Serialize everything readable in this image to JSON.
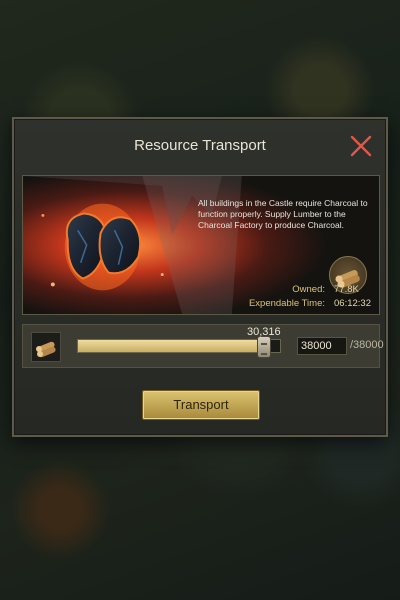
{
  "dialog": {
    "title": "Resource Transport",
    "description": "All buildings in the Castle require Charcoal to function properly. Supply Lumber to the Charcoal Factory to produce Charcoal.",
    "owned_label": "Owned:",
    "owned_value": "77.8K",
    "time_label": "Expendable Time:",
    "time_value": "06:12:32",
    "close_icon": "close-icon"
  },
  "slider": {
    "current_label": "30,316",
    "input_value": "38000",
    "max_label": "/38000",
    "fill_fraction": 0.92,
    "resource_icon": "lumber-icon"
  },
  "actions": {
    "transport_label": "Transport"
  },
  "colors": {
    "accent_gold": "#d4bc6a",
    "close_red": "#e0584a",
    "panel_bg": "#2b2d28"
  }
}
